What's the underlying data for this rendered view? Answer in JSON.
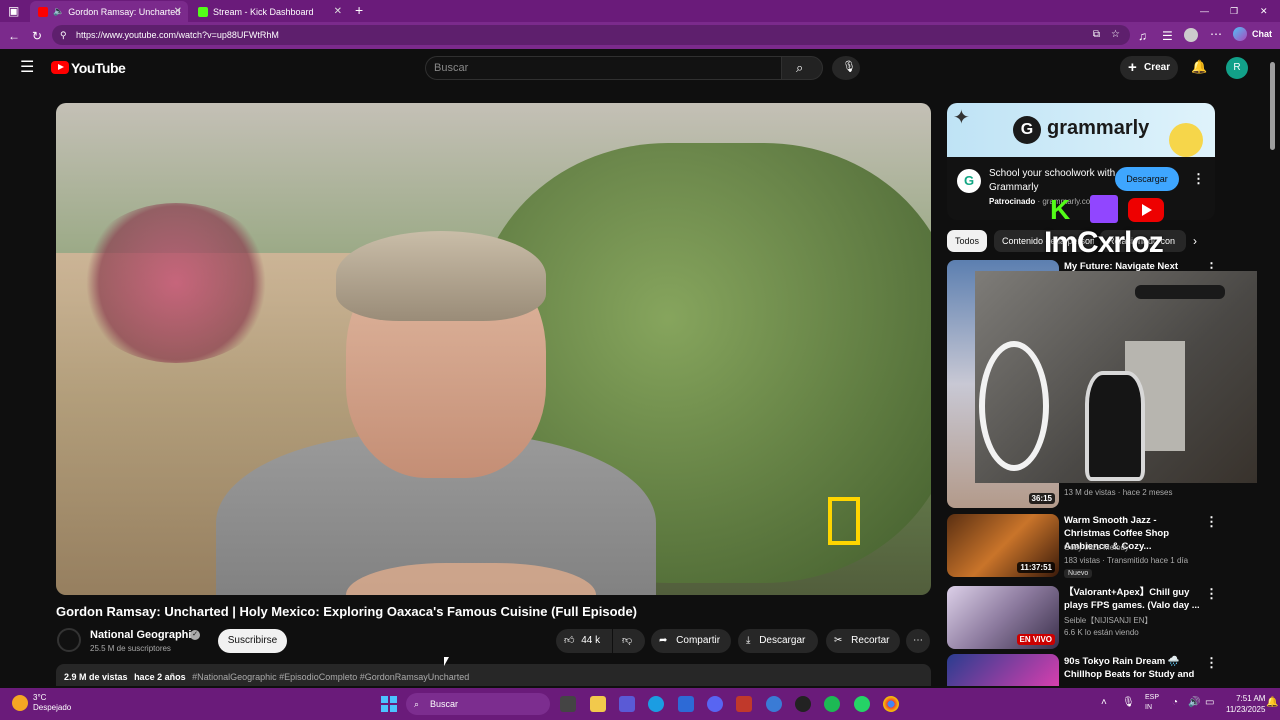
{
  "browser": {
    "tabs": [
      {
        "title": "Gordon Ramsay: Uncharted"
      },
      {
        "title": "Stream - Kick Dashboard"
      }
    ],
    "url": "https://www.youtube.com/watch?v=up88UFWtRhM",
    "chat_label": "Chat"
  },
  "youtube": {
    "logo_text": "YouTube",
    "search_placeholder": "Buscar",
    "create_label": "Crear",
    "avatar_letter": "R"
  },
  "video": {
    "title": "Gordon Ramsay: Uncharted | Holy Mexico: Exploring Oaxaca's Famous Cuisine (Full Episode)",
    "channel": "National Geographic",
    "subscribers": "25.5 M de suscriptores",
    "subscribe_label": "Suscribirse",
    "likes": "44 k",
    "share_label": "Compartir",
    "download_label": "Descargar",
    "clip_label": "Recortar",
    "views": "2.9 M de vistas",
    "age": "hace 2 años",
    "hashtags": "#NationalGeographic #EpisodioCompleto #GordonRamsayUncharted"
  },
  "ad": {
    "brand_word": "grammarly",
    "headline": "School your schoolwork with Grammarly",
    "sponsored_label": "Patrocinado",
    "domain": "grammarly.co...",
    "cta": "Descargar"
  },
  "chips": [
    "Todos",
    "Contenido de la persona",
    "Relacionado con"
  ],
  "stream_overlay": {
    "name": "ImCxrloz"
  },
  "recommendations": [
    {
      "title": "My Future: Navigate Next Steps",
      "meta1": "",
      "meta2": "13 M de vistas · hace 2 meses",
      "duration": "36:15"
    },
    {
      "title": "Warm Smooth Jazz - Christmas Coffee Shop Ambience & Cozy...",
      "meta1": "Cozy Jazz Melody",
      "meta2": "183 vistas · Transmitido hace 1 día",
      "duration": "11:37:51",
      "badge": "Nuevo"
    },
    {
      "title": "【Valorant+Apex】Chill guy plays FPS games. (Valo day ...",
      "meta1": "Seible【NIJISANJI EN】",
      "meta2": "6.6 K lo están viendo",
      "live": "EN VIVO"
    },
    {
      "title": "90s Tokyo Rain Dream 🌧️ Chillhop Beats for Study and ...",
      "meta1": "",
      "meta2": ""
    }
  ],
  "taskbar": {
    "temp": "3°C",
    "weather": "Despejado",
    "search": "Buscar",
    "lang1": "ESP",
    "lang2": "IN",
    "time": "7:51 AM",
    "date": "11/23/2025"
  },
  "colors": {
    "browser_purple": "#7b2a8c",
    "youtube_red": "#ff0000",
    "cta_blue": "#3ea6ff"
  }
}
